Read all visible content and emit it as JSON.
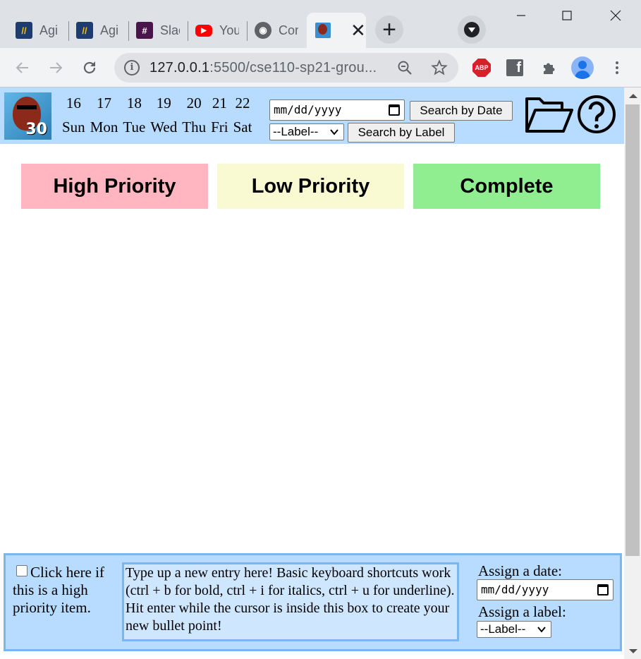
{
  "browser": {
    "tabs": [
      {
        "title": "Agi",
        "icon": "agile-icon"
      },
      {
        "title": "Agi",
        "icon": "agile-icon"
      },
      {
        "title": "Slac",
        "icon": "slack-icon"
      },
      {
        "title": "You",
        "icon": "youtube-icon"
      },
      {
        "title": "Con",
        "icon": "github-icon"
      }
    ],
    "active_tab": {
      "icon": "app-logo-icon"
    },
    "url_host": "127.0.0.1",
    "url_rest": ":5500/cse110-sp21-grou...",
    "extensions": {
      "abp_label": "ABP"
    }
  },
  "app": {
    "logo_number": "30",
    "days": [
      {
        "num": "16",
        "name": "Sun"
      },
      {
        "num": "17",
        "name": "Mon"
      },
      {
        "num": "18",
        "name": "Tue"
      },
      {
        "num": "19",
        "name": "Wed"
      },
      {
        "num": "20",
        "name": "Thu"
      },
      {
        "num": "21",
        "name": "Fri"
      },
      {
        "num": "22",
        "name": "Sat"
      }
    ],
    "date_placeholder": "mm/dd/yyyy",
    "search_date_label": "Search by Date",
    "label_select_value": "--Label--",
    "search_label_label": "Search by Label",
    "columns": [
      {
        "label": "High Priority",
        "color": "#ffb6c1"
      },
      {
        "label": "Low Priority",
        "color": "#fafad2"
      },
      {
        "label": "Complete",
        "color": "#90ee90"
      }
    ],
    "entry": {
      "priority_text": "Click here if this is a high priority item.",
      "editor_text": "Type up a new entry here! Basic keyboard shortcuts work (ctrl + b for bold, ctrl + i for italics, ctrl + u for underline). Hit enter while the cursor is inside this box to create your new bullet point!",
      "assign_date_label": "Assign a date:",
      "assign_label_label": "Assign a label:",
      "date_placeholder": "mm/dd/yyyy",
      "label_select_value": "--Label--"
    }
  },
  "colors": {
    "header_bg": "#b8dcff",
    "entry_border": "#7ab6f0"
  }
}
